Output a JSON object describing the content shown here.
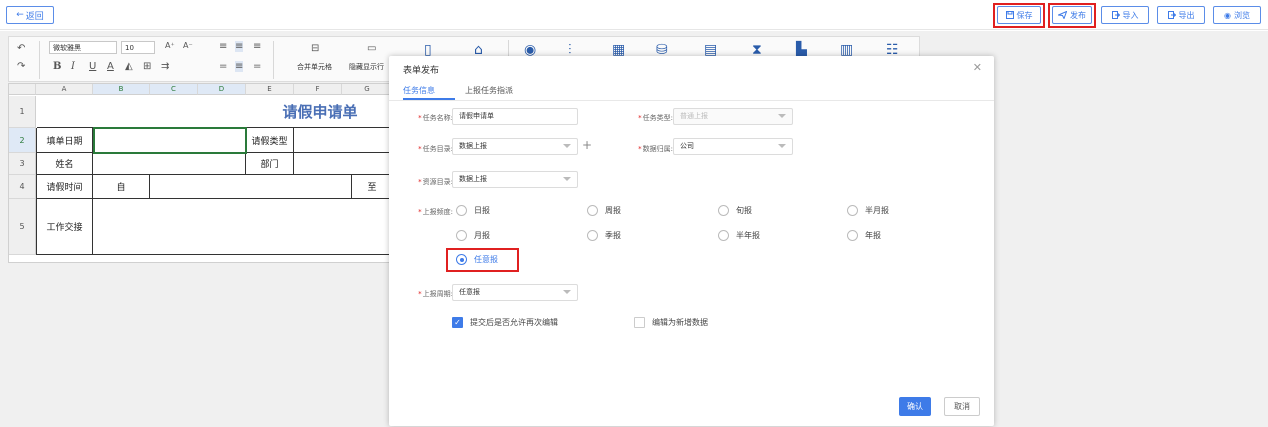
{
  "toolbar": {
    "back": "返回",
    "save": "保存",
    "publish": "发布",
    "import": "导入",
    "export": "导出",
    "preview": "浏览"
  },
  "ribbon": {
    "font_name": "微软雅黑",
    "font_size": "10",
    "merge_label": "合并单元格",
    "hide_label": "隐藏显示行"
  },
  "sheet": {
    "columns": [
      "A",
      "B",
      "C",
      "D",
      "E",
      "F",
      "G"
    ],
    "rows": [
      "1",
      "2",
      "3",
      "4",
      "5"
    ],
    "title": "请假申请单",
    "fill_date": "填单日期",
    "leave_type": "请假类型",
    "name": "姓名",
    "dept": "部门",
    "leave_time": "请假时间",
    "from": "自",
    "to": "至",
    "handover": "工作交接"
  },
  "modal": {
    "title": "表单发布",
    "tabs": [
      "任务信息",
      "上报任务指派"
    ],
    "task_name_label": "任务名称:",
    "task_name_value": "请假申请单",
    "task_type_label": "任务类型:",
    "task_type_value": "普通上报",
    "task_dir_label": "任务目录:",
    "task_dir_value": "数据上报",
    "data_owner_label": "数据归属:",
    "data_owner_value": "公司",
    "res_dir_label": "资源目录:",
    "res_dir_value": "数据上报",
    "freq_label": "上报频度:",
    "freq_options": [
      "日报",
      "周报",
      "旬报",
      "半月报",
      "月报",
      "季报",
      "半年报",
      "年报",
      "任意报"
    ],
    "freq_selected": "任意报",
    "period_label": "上报周期:",
    "period_value": "任意报",
    "check_reedit": "提交后是否允许再次编辑",
    "check_reedit_checked": true,
    "check_new": "编辑为新增数据",
    "check_new_checked": false,
    "ok": "确认",
    "cancel": "取消"
  },
  "colors": {
    "accent": "#3e7be8",
    "highlight": "#e02020",
    "title": "#4a6fb5"
  }
}
